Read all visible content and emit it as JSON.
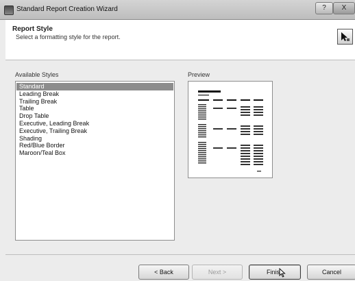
{
  "window": {
    "title": "Standard Report Creation Wizard",
    "help_glyph": "?",
    "close_glyph": "X"
  },
  "header": {
    "title": "Report Style",
    "subtitle": "Select a formatting style for the report."
  },
  "styles": {
    "label": "Available Styles",
    "items": [
      "Standard",
      "Leading Break",
      "Trailing Break",
      "Table",
      "Drop Table",
      "Executive, Leading Break",
      "Executive, Trailing Break",
      "Shading",
      "Red/Blue Border",
      "Maroon/Teal Box"
    ],
    "selected": "Standard"
  },
  "preview": {
    "label": "Preview"
  },
  "buttons": {
    "back": "< Back",
    "next": "Next >",
    "finish": "Finish",
    "cancel": "Cancel"
  }
}
